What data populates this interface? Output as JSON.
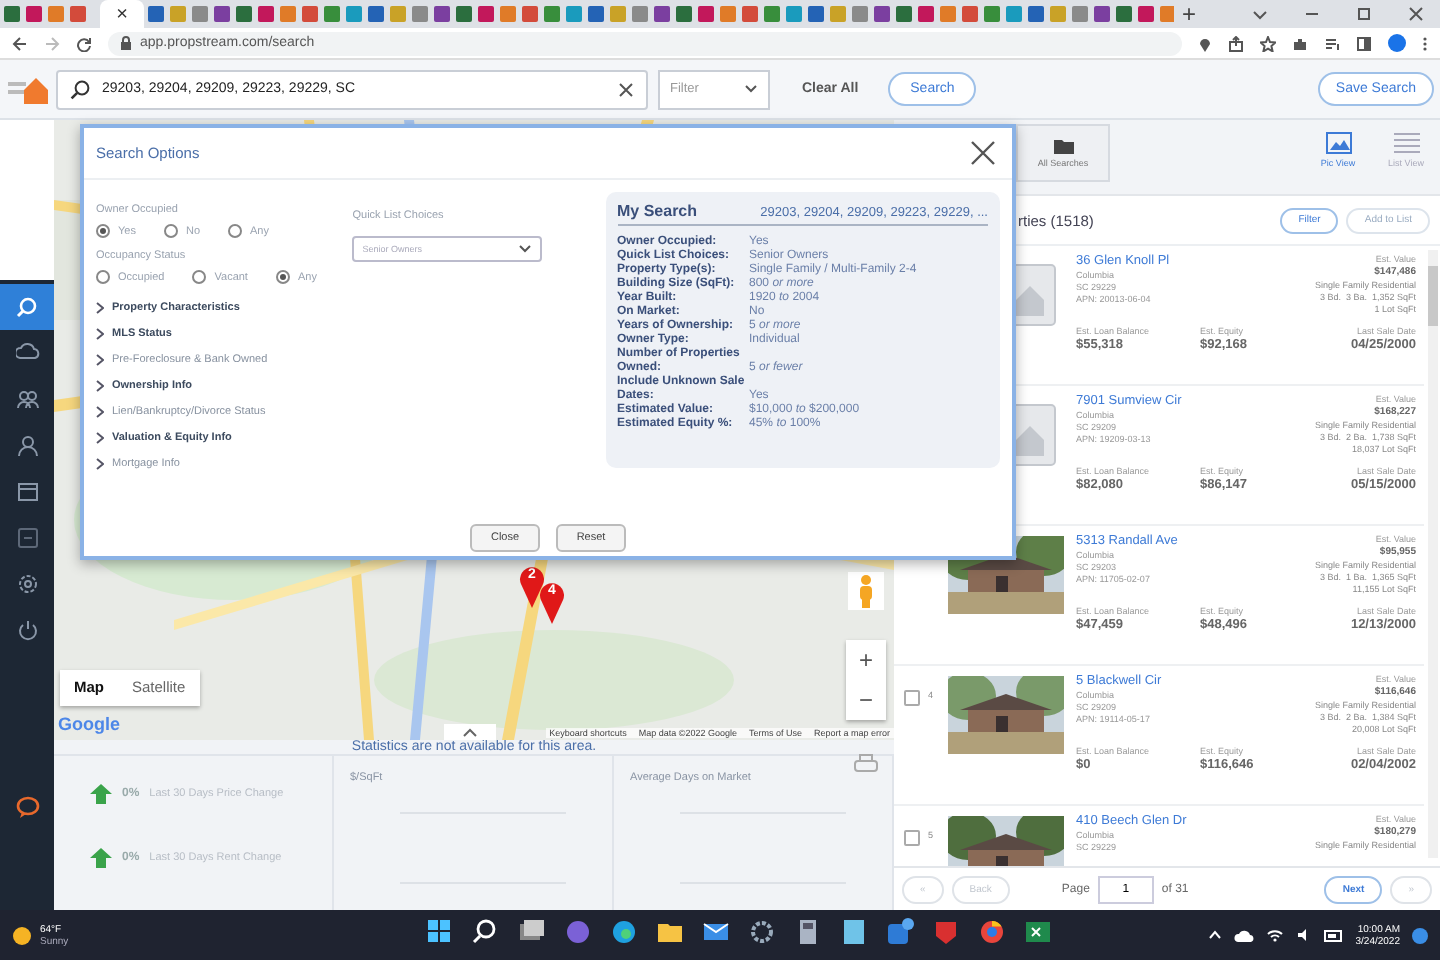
{
  "browser": {
    "tab_close": "×",
    "new_tab": "+",
    "url": "app.propstream.com/search"
  },
  "header": {
    "search_value": "29203, 29204, 29209, 29223, 29229, SC",
    "filter_placeholder": "Filter",
    "clear_all": "Clear All",
    "search_button": "Search",
    "save_search": "Save Search"
  },
  "sidebar": {
    "items": [
      {
        "selected": true
      },
      {
        "selected": false
      },
      {
        "selected": false
      },
      {
        "selected": false
      },
      {
        "selected": false
      },
      {
        "selected": false
      },
      {
        "selected": false
      },
      {
        "selected": false
      }
    ]
  },
  "modal": {
    "title": "Search Options",
    "owner_occupied": {
      "label": "Owner Occupied",
      "options": [
        {
          "label": "Yes",
          "selected": true
        },
        {
          "label": "No",
          "selected": false
        },
        {
          "label": "Any",
          "selected": false
        }
      ]
    },
    "occupancy_status": {
      "label": "Occupancy Status",
      "options": [
        {
          "label": "Occupied",
          "selected": false
        },
        {
          "label": "Vacant",
          "selected": false
        },
        {
          "label": "Any",
          "selected": true
        }
      ]
    },
    "sections": [
      {
        "label": "Property Characteristics",
        "active": true
      },
      {
        "label": "MLS Status",
        "active": true
      },
      {
        "label": "Pre-Foreclosure & Bank Owned",
        "active": false
      },
      {
        "label": "Ownership Info",
        "active": true
      },
      {
        "label": "Lien/Bankruptcy/Divorce Status",
        "active": false
      },
      {
        "label": "Valuation & Equity Info",
        "active": true
      },
      {
        "label": "Mortgage Info",
        "active": false
      }
    ],
    "quick_list": {
      "label": "Quick List Choices",
      "value": "Senior Owners"
    },
    "my_search": {
      "title": "My Search",
      "query": "29203, 29204, 29209, 29223, 29229, ...",
      "criteria": [
        {
          "label": "Owner Occupied:",
          "value": "Yes"
        },
        {
          "label": "Quick List Choices:",
          "value": "Senior Owners"
        },
        {
          "label": "Property Type(s):",
          "value": "Single Family / Multi-Family 2-4"
        },
        {
          "label": "Building Size (SqFt):",
          "value": "800 *or more*"
        },
        {
          "label": "Year Built:",
          "value": "1920 *to* 2004"
        },
        {
          "label": "On Market:",
          "value": "No"
        },
        {
          "label": "Years of Ownership:",
          "value": "5 *or more*"
        },
        {
          "label": "Owner Type:",
          "value": "Individual"
        },
        {
          "label": "Number of Properties Owned:",
          "value": "5 *or fewer*"
        },
        {
          "label": "Include Unknown Sale Dates:",
          "value": "Yes"
        },
        {
          "label": "Estimated Value:",
          "value": "$10,000 *to* $200,000"
        },
        {
          "label": "Estimated Equity %:",
          "value": "45% *to* 100%"
        }
      ]
    },
    "buttons": [
      "Close",
      "Reset"
    ]
  },
  "map": {
    "markers": [
      {
        "label": "2"
      },
      {
        "label": "4"
      }
    ],
    "map_type": [
      {
        "label": "Map",
        "selected": true
      },
      {
        "label": "Satellite",
        "selected": false
      }
    ],
    "logo": "Google",
    "zoom_in": "+",
    "zoom_out": "−",
    "attribution": [
      "Keyboard shortcuts",
      "Map data ©2022 Google",
      "Terms of Use",
      "Report a map error"
    ]
  },
  "stats": {
    "message": "Statistics are not available for this area.",
    "changes": [
      {
        "value": "0%",
        "label": "Last 30 Days Price Change"
      },
      {
        "value": "0%",
        "label": "Last 30 Days Rent Change"
      }
    ],
    "panels": [
      {
        "title": "$/SqFt"
      },
      {
        "title": "Average Days on Market"
      }
    ]
  },
  "results": {
    "all_searches": "All Searches",
    "views": [
      {
        "label": "Pic View",
        "selected": true
      },
      {
        "label": "List View",
        "selected": false
      }
    ],
    "count_title": "rties (1518)",
    "filter": "Filter",
    "add_to_list": {
      "label": "Add to List",
      "disabled": true
    },
    "properties": [
      {
        "kind": "placeholder",
        "address": "36 Glen Knoll Pl",
        "city": "Columbia",
        "state_zip": "SC 29229",
        "apn": "APN: 20013-06-04",
        "value_label": "Est. Value",
        "value": "$147,486",
        "type": "Single Family Residential",
        "rooms": "3 Bd.  3 Ba.  1,352 SqFt",
        "lot": "1 Lot SqFt",
        "loan_label": "Est. Loan Balance",
        "loan": "$55,318",
        "equity_label": "Est. Equity",
        "equity": "$92,168",
        "sale_label": "Last Sale Date",
        "sale_date": "04/25/2000"
      },
      {
        "kind": "placeholder",
        "address": "7901 Sumview Cir",
        "city": "Columbia",
        "state_zip": "SC 29209",
        "apn": "APN: 19209-03-13",
        "value_label": "Est. Value",
        "value": "$168,227",
        "type": "Single Family Residential",
        "rooms": "3 Bd.  2 Ba.  1,738 SqFt",
        "lot": "18,037 Lot SqFt",
        "loan_label": "Est. Loan Balance",
        "loan": "$82,080",
        "equity_label": "Est. Equity",
        "equity": "$86,147",
        "sale_label": "Last Sale Date",
        "sale_date": "05/15/2000"
      },
      {
        "kind": "picture",
        "address": "5313 Randall Ave",
        "city": "Columbia",
        "state_zip": "SC 29203",
        "apn": "APN: 11705-02-07",
        "value_label": "Est. Value",
        "value": "$95,955",
        "type": "Single Family Residential",
        "rooms": "3 Bd.  1 Ba.  1,365 SqFt",
        "lot": "11,155 Lot SqFt",
        "loan_label": "Est. Loan Balance",
        "loan": "$47,459",
        "equity_label": "Est. Equity",
        "equity": "$48,496",
        "sale_label": "Last Sale Date",
        "sale_date": "12/13/2000"
      },
      {
        "number": "4",
        "checked": false,
        "kind": "picture",
        "address": "5 Blackwell Cir",
        "city": "Columbia",
        "state_zip": "SC 29209",
        "apn": "APN: 19114-05-17",
        "value_label": "Est. Value",
        "value": "$116,646",
        "type": "Single Family Residential",
        "rooms": "3 Bd.  2 Ba.  1,384 SqFt",
        "lot": "20,008 Lot SqFt",
        "loan_label": "Est. Loan Balance",
        "loan": "$0",
        "equity_label": "Est. Equity",
        "equity": "$116,646",
        "sale_label": "Last Sale Date",
        "sale_date": "02/04/2002"
      },
      {
        "number": "5",
        "checked": false,
        "kind": "picture",
        "address": "410 Beech Glen Dr",
        "city": "Columbia",
        "state_zip": "SC 29229",
        "value_label": "Est. Value",
        "value": "$180,279",
        "type": "Single Family Residential"
      }
    ],
    "pagination": {
      "first": "«",
      "back": {
        "label": "Back",
        "disabled": true
      },
      "page_label": "Page",
      "page": "1",
      "of": "of 31",
      "next": "Next",
      "last": "»"
    }
  },
  "taskbar": {
    "temperature": "64°F",
    "condition": "Sunny",
    "time": "10:00 AM",
    "date": "3/24/2022"
  }
}
